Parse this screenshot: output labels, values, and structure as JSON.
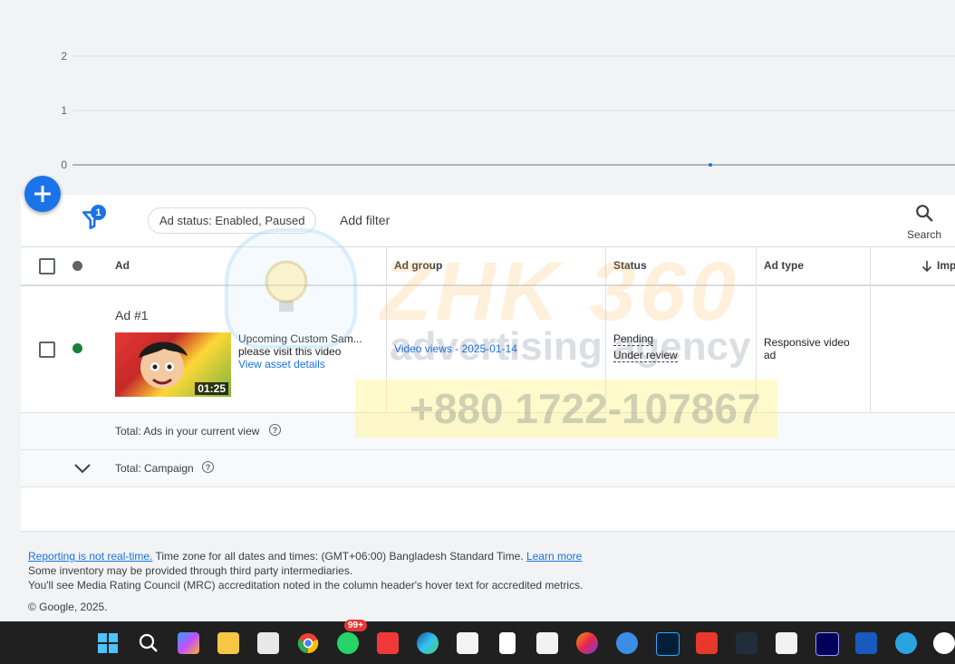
{
  "chart": {
    "y_ticks": [
      "2",
      "1",
      "0"
    ]
  },
  "toolbar": {
    "filter_count": "1",
    "status_chip": "Ad status: Enabled, Paused",
    "add_filter": "Add filter",
    "search_label": "Search"
  },
  "table": {
    "columns": [
      "Ad",
      "Ad group",
      "Status",
      "Ad type",
      "Imp"
    ],
    "row": {
      "title": "Ad #1",
      "thumbnail_duration": "01:25",
      "headline": "Upcoming Custom Sam...",
      "description": "please visit this video",
      "asset_link": "View asset details",
      "ad_group": "Video views - 2025-01-14",
      "status_1": "Pending",
      "status_2": "Under review",
      "ad_type_1": "Responsive video",
      "ad_type_2": "ad"
    },
    "totals": {
      "current_view": "Total: Ads in your current view",
      "campaign": "Total: Campaign"
    }
  },
  "footer": {
    "realtime_link": "Reporting is not real-time.",
    "timezone": " Time zone for all dates and times: (GMT+06:00) Bangladesh Standard Time. ",
    "learn_more": "Learn more",
    "line2": "Some inventory may be provided through third party intermediaries.",
    "line3": "You'll see Media Rating Council (MRC) accreditation noted in the column header's hover text for accredited metrics.",
    "copyright": "© Google, 2025."
  },
  "watermark": {
    "brand": "ZHK 360",
    "tagline": "advertising agency",
    "phone": "+880 1722-107867"
  },
  "taskbar": {
    "whatsapp_badge": "99+"
  },
  "colors": {
    "accent": "#1a73e8",
    "enabled": "#188038",
    "header_dot": "#5f6368"
  }
}
